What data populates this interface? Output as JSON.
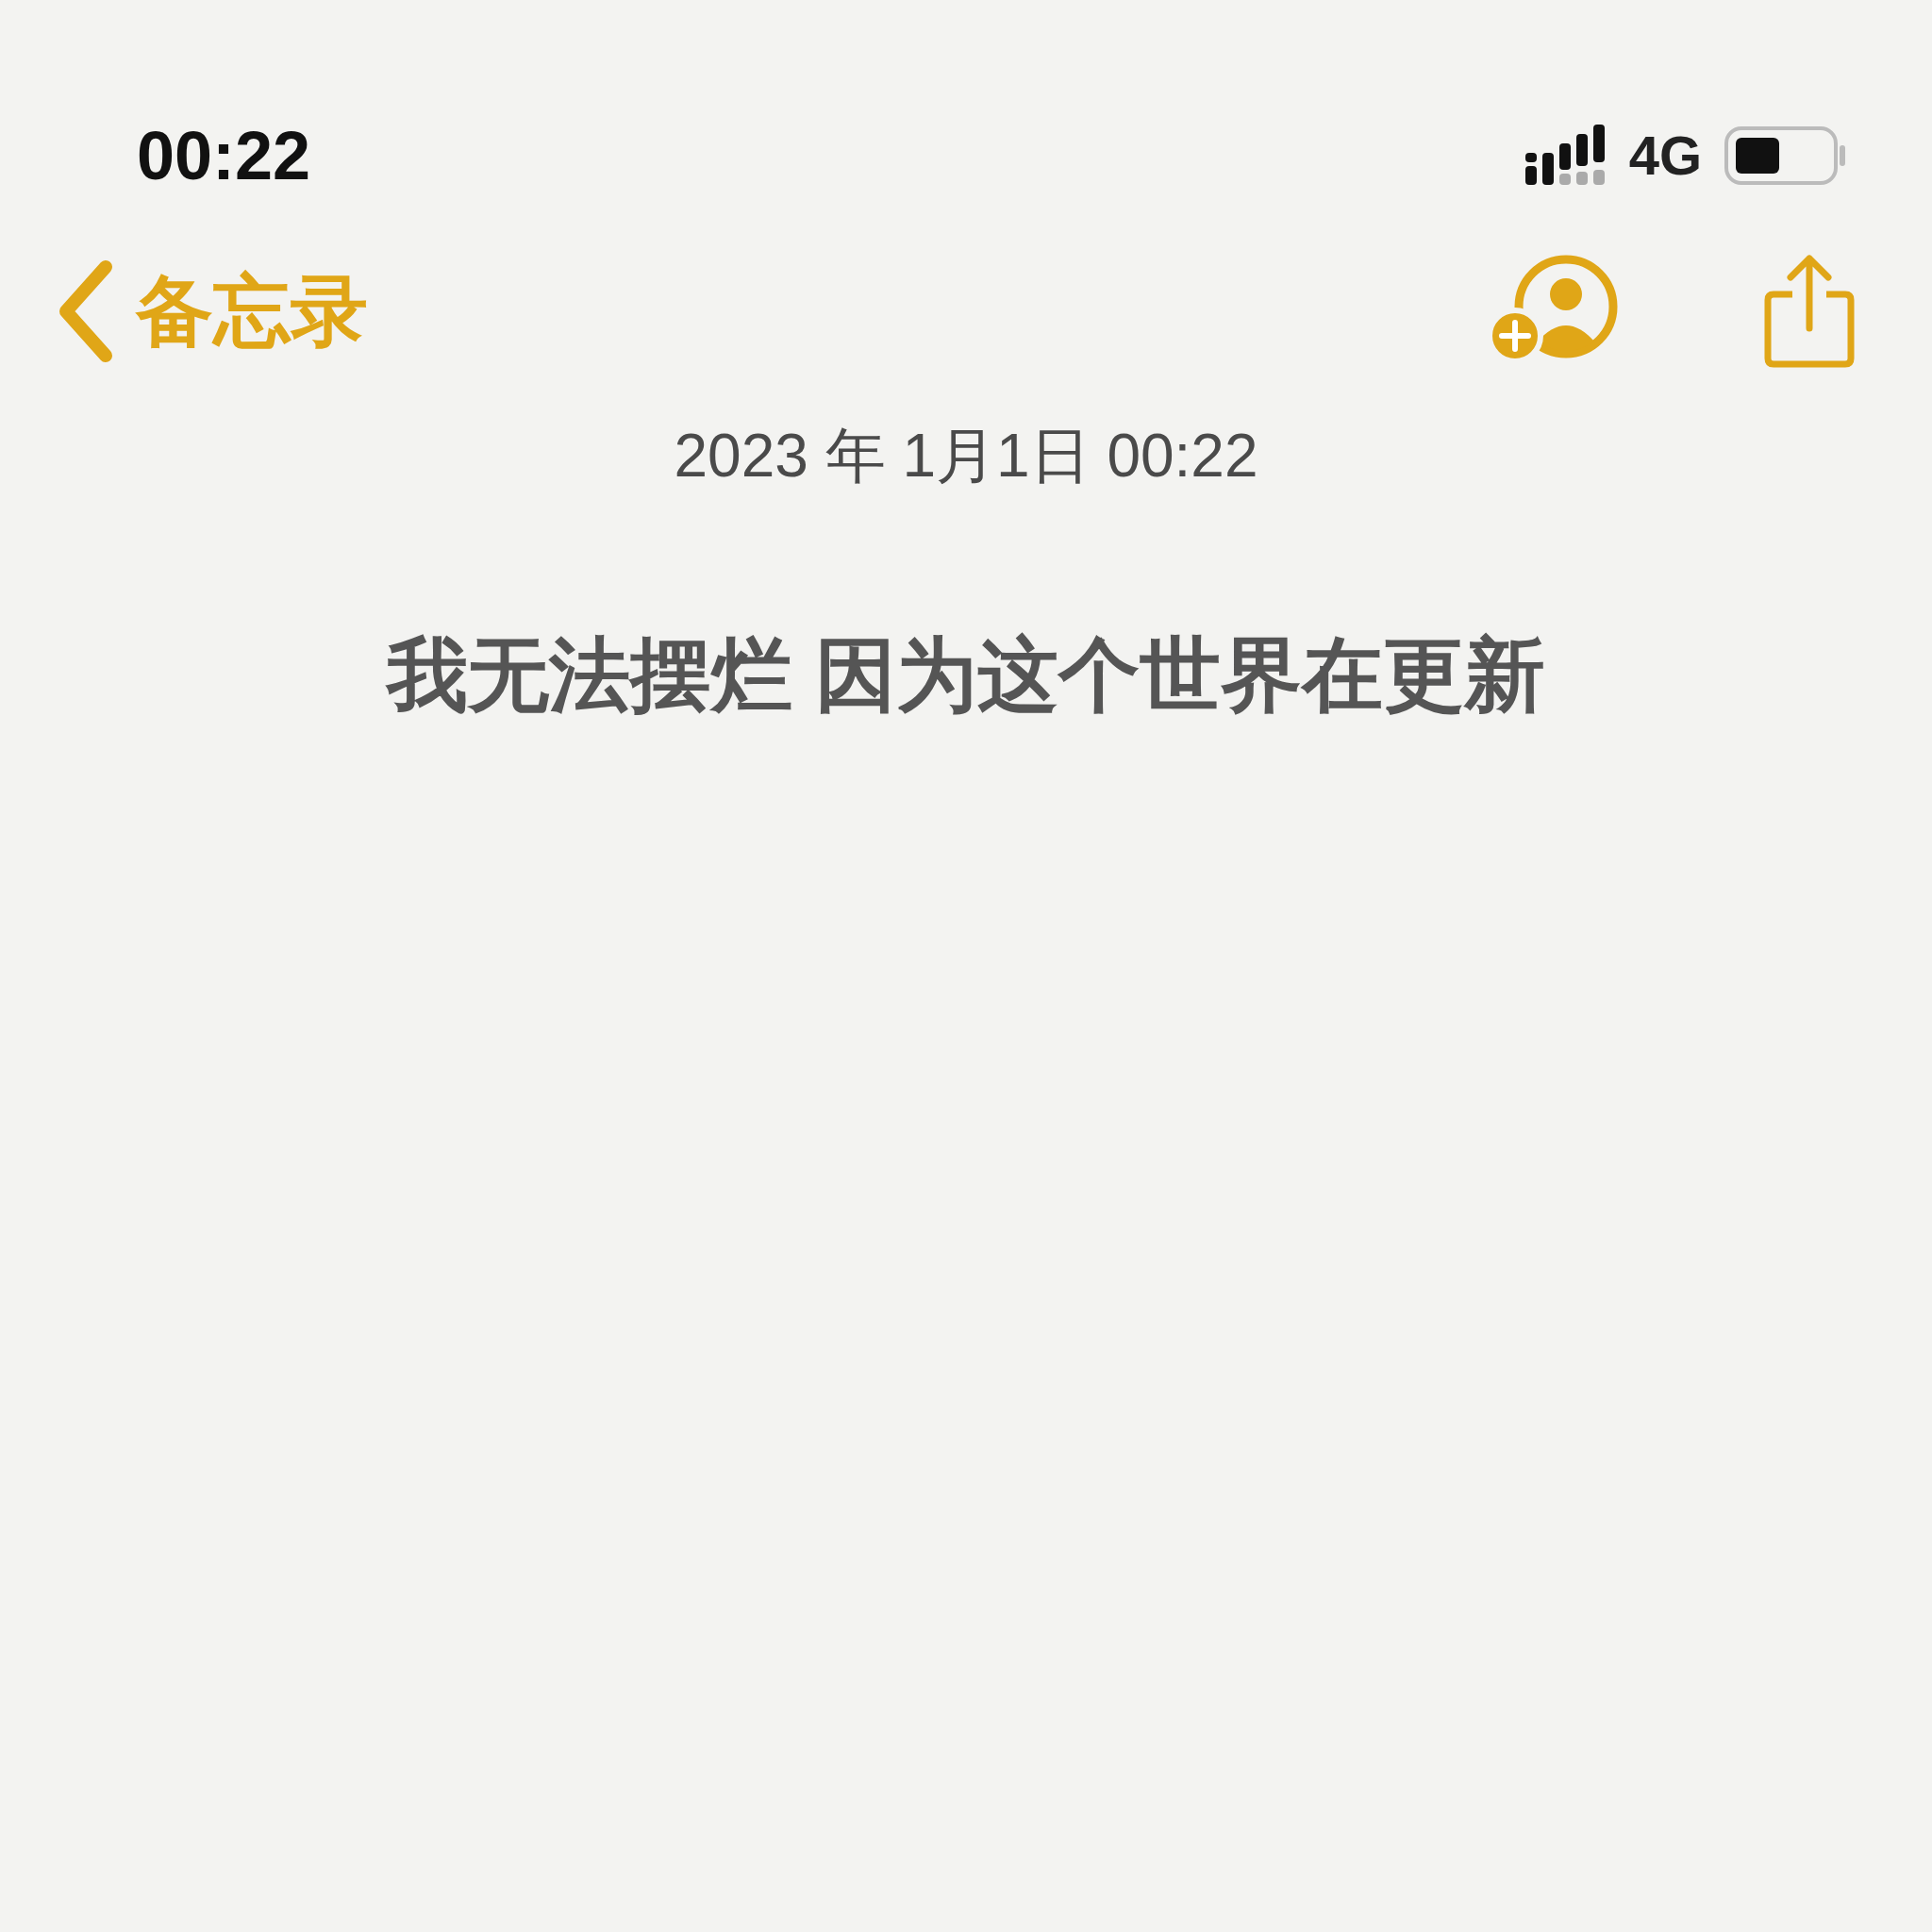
{
  "status_bar": {
    "time": "00:22",
    "network": "4G"
  },
  "nav": {
    "back_label": "备忘录"
  },
  "note": {
    "date": "2023 年 1月1日 00:22",
    "body": "我无法摆烂 因为这个世界在更新"
  }
}
